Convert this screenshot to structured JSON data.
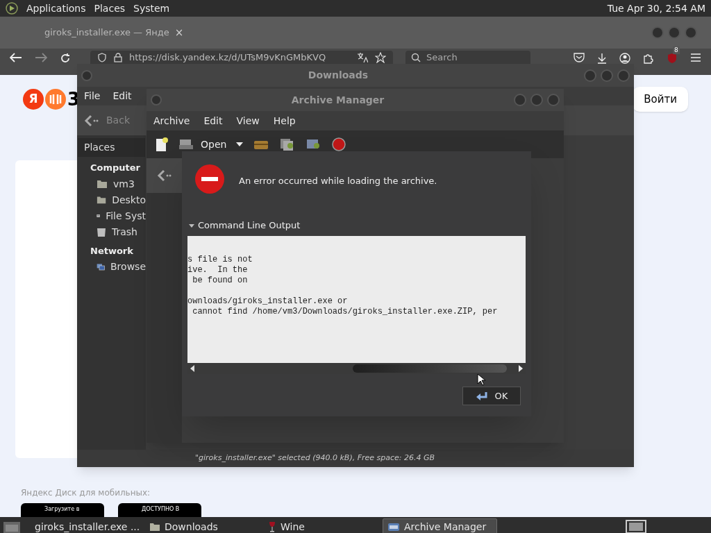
{
  "top_panel": {
    "menus": [
      "Applications",
      "Places",
      "System"
    ],
    "clock": "Tue Apr 30, 2:54 AM"
  },
  "browser": {
    "tab": {
      "title": "giroks_installer.exe — Янде",
      "close": "×"
    },
    "url": "https://disk.yandex.kz/d/UTsM9vKnGMbKVQ",
    "search_placeholder": "Search",
    "addon_badge": "8",
    "page": {
      "logo_letter": "Я",
      "logo_text": "3",
      "login_button": "Войти",
      "mobile_caption": "Яндекс Диск для мобильных:",
      "store_badges": [
        "Загрузите в",
        "ДОСТУПНО В"
      ]
    }
  },
  "file_manager": {
    "title": "Downloads",
    "menus": [
      "File",
      "Edit"
    ],
    "back": "Back",
    "sidebar": {
      "header": "Places",
      "sections": [
        {
          "title": "Computer",
          "items": [
            {
              "label": "vm3",
              "kind": "home"
            },
            {
              "label": "Deskto",
              "kind": "desktop"
            },
            {
              "label": "File Syst",
              "kind": "drive"
            },
            {
              "label": "Trash",
              "kind": "trash"
            }
          ]
        },
        {
          "title": "Network",
          "items": [
            {
              "label": "Browse",
              "kind": "network"
            }
          ]
        }
      ]
    },
    "status": "\"giroks_installer.exe\" selected (940.0 kB), Free space: 26.4 GB"
  },
  "archive_manager": {
    "title": "Archive Manager",
    "menus": [
      "Archive",
      "Edit",
      "View",
      "Help"
    ],
    "open": "Open"
  },
  "error_dialog": {
    "message": "An error occurred while loading the archive.",
    "expander": {
      "label": "Command Line Output",
      "expanded": true
    },
    "output_lines": [
      {
        "text": "s file is not",
        "gap_before": false
      },
      {
        "text": "ive.  In the",
        "gap_before": false
      },
      {
        "text": " be found on",
        "gap_before": false
      },
      {
        "text": "ownloads/giroks_installer.exe or",
        "gap_before": true
      },
      {
        "text": " cannot find /home/vm3/Downloads/giroks_installer.exe.ZIP, per",
        "gap_before": false
      }
    ],
    "ok": "OK"
  },
  "taskbar": {
    "items": [
      {
        "label": "giroks_installer.exe ...",
        "kind": "browser",
        "selected": false
      },
      {
        "label": "Downloads",
        "kind": "folder",
        "selected": false
      },
      {
        "label": "Wine",
        "kind": "wine",
        "selected": false
      },
      {
        "label": "Archive Manager",
        "kind": "archive",
        "selected": true
      }
    ]
  }
}
